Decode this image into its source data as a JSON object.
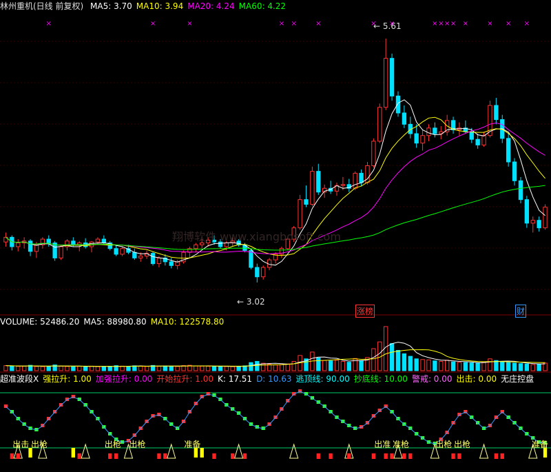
{
  "chart_data": [
    {
      "type": "candlestick",
      "title": "林州重机(日线 前复权)",
      "indicators": [
        {
          "name": "MA5",
          "value": 3.7,
          "color": "#ffffff"
        },
        {
          "name": "MA10",
          "value": 3.94,
          "color": "#ffff00"
        },
        {
          "name": "MA20",
          "value": 4.24,
          "color": "#ff00ff"
        },
        {
          "name": "MA60",
          "value": 4.22,
          "color": "#00ff00"
        }
      ],
      "annotations": {
        "high_label": "5.61",
        "low_label": "3.02"
      },
      "ylim": [
        2.8,
        5.8
      ],
      "watermark": "翔博软件 www.xiangbosoft.com",
      "events": [
        {
          "label": "涨榜",
          "color": "#ff3333"
        },
        {
          "label": "财",
          "color": "#3399ff"
        }
      ],
      "up_color": "#ff3333",
      "down_color": "#00e0ff",
      "ohlc": [
        [
          3.45,
          3.55,
          3.4,
          3.5
        ],
        [
          3.5,
          3.52,
          3.36,
          3.4
        ],
        [
          3.4,
          3.48,
          3.35,
          3.44
        ],
        [
          3.44,
          3.5,
          3.38,
          3.46
        ],
        [
          3.46,
          3.48,
          3.3,
          3.35
        ],
        [
          3.35,
          3.45,
          3.28,
          3.42
        ],
        [
          3.42,
          3.5,
          3.38,
          3.48
        ],
        [
          3.48,
          3.52,
          3.4,
          3.44
        ],
        [
          3.44,
          3.46,
          3.25,
          3.28
        ],
        [
          3.28,
          3.42,
          3.26,
          3.4
        ],
        [
          3.4,
          3.48,
          3.36,
          3.46
        ],
        [
          3.46,
          3.5,
          3.4,
          3.42
        ],
        [
          3.42,
          3.46,
          3.35,
          3.44
        ],
        [
          3.44,
          3.49,
          3.38,
          3.4
        ],
        [
          3.4,
          3.46,
          3.34,
          3.45
        ],
        [
          3.45,
          3.5,
          3.42,
          3.48
        ],
        [
          3.48,
          3.52,
          3.42,
          3.44
        ],
        [
          3.44,
          3.46,
          3.36,
          3.38
        ],
        [
          3.38,
          3.42,
          3.3,
          3.32
        ],
        [
          3.32,
          3.4,
          3.3,
          3.38
        ],
        [
          3.38,
          3.42,
          3.32,
          3.34
        ],
        [
          3.34,
          3.38,
          3.26,
          3.28
        ],
        [
          3.28,
          3.34,
          3.24,
          3.3
        ],
        [
          3.3,
          3.36,
          3.27,
          3.33
        ],
        [
          3.33,
          3.35,
          3.2,
          3.22
        ],
        [
          3.22,
          3.3,
          3.18,
          3.28
        ],
        [
          3.28,
          3.32,
          3.2,
          3.24
        ],
        [
          3.24,
          3.28,
          3.17,
          3.2
        ],
        [
          3.2,
          3.26,
          3.16,
          3.24
        ],
        [
          3.24,
          3.36,
          3.22,
          3.34
        ],
        [
          3.34,
          3.4,
          3.28,
          3.38
        ],
        [
          3.38,
          3.44,
          3.34,
          3.42
        ],
        [
          3.42,
          3.48,
          3.38,
          3.44
        ],
        [
          3.44,
          3.5,
          3.4,
          3.47
        ],
        [
          3.47,
          3.52,
          3.42,
          3.45
        ],
        [
          3.45,
          3.48,
          3.38,
          3.4
        ],
        [
          3.4,
          3.46,
          3.36,
          3.44
        ],
        [
          3.44,
          3.5,
          3.4,
          3.46
        ],
        [
          3.46,
          3.48,
          3.4,
          3.42
        ],
        [
          3.42,
          3.44,
          3.34,
          3.36
        ],
        [
          3.36,
          3.38,
          3.16,
          3.18
        ],
        [
          3.18,
          3.22,
          3.02,
          3.08
        ],
        [
          3.08,
          3.2,
          3.05,
          3.18
        ],
        [
          3.18,
          3.28,
          3.15,
          3.26
        ],
        [
          3.26,
          3.34,
          3.22,
          3.32
        ],
        [
          3.32,
          3.4,
          3.28,
          3.38
        ],
        [
          3.38,
          3.5,
          3.36,
          3.48
        ],
        [
          3.48,
          3.62,
          3.45,
          3.6
        ],
        [
          3.6,
          3.95,
          3.58,
          3.9
        ],
        [
          3.9,
          4.05,
          3.82,
          3.85
        ],
        [
          3.85,
          4.25,
          3.83,
          4.2
        ],
        [
          4.2,
          4.28,
          3.95,
          3.98
        ],
        [
          3.98,
          4.06,
          3.92,
          4.02
        ],
        [
          4.02,
          4.1,
          3.96,
          3.99
        ],
        [
          3.99,
          4.08,
          3.94,
          4.05
        ],
        [
          4.05,
          4.14,
          4.0,
          4.06
        ],
        [
          4.06,
          4.12,
          3.98,
          4.02
        ],
        [
          4.02,
          4.2,
          4.0,
          4.18
        ],
        [
          4.18,
          4.22,
          4.04,
          4.08
        ],
        [
          4.08,
          4.3,
          4.06,
          4.26
        ],
        [
          4.26,
          4.55,
          4.24,
          4.52
        ],
        [
          4.52,
          4.92,
          4.5,
          4.88
        ],
        [
          4.88,
          5.61,
          4.85,
          5.4
        ],
        [
          5.4,
          5.45,
          4.95,
          5.0
        ],
        [
          5.0,
          5.05,
          4.78,
          4.82
        ],
        [
          4.82,
          4.9,
          4.66,
          4.7
        ],
        [
          4.7,
          4.78,
          4.55,
          4.6
        ],
        [
          4.6,
          4.7,
          4.45,
          4.5
        ],
        [
          4.5,
          4.64,
          4.42,
          4.58
        ],
        [
          4.58,
          4.7,
          4.52,
          4.66
        ],
        [
          4.66,
          4.72,
          4.56,
          4.6
        ],
        [
          4.6,
          4.68,
          4.54,
          4.62
        ],
        [
          4.62,
          4.8,
          4.58,
          4.74
        ],
        [
          4.74,
          4.78,
          4.6,
          4.64
        ],
        [
          4.64,
          4.72,
          4.58,
          4.66
        ],
        [
          4.66,
          4.74,
          4.6,
          4.62
        ],
        [
          4.62,
          4.66,
          4.5,
          4.54
        ],
        [
          4.54,
          4.6,
          4.44,
          4.48
        ],
        [
          4.48,
          4.62,
          4.46,
          4.58
        ],
        [
          4.58,
          4.95,
          4.56,
          4.9
        ],
        [
          4.9,
          4.98,
          4.7,
          4.75
        ],
        [
          4.75,
          4.8,
          4.5,
          4.55
        ],
        [
          4.55,
          4.6,
          4.25,
          4.3
        ],
        [
          4.3,
          4.34,
          4.05,
          4.1
        ],
        [
          4.1,
          4.14,
          3.86,
          3.9
        ],
        [
          3.9,
          3.94,
          3.6,
          3.65
        ],
        [
          3.65,
          3.72,
          3.55,
          3.68
        ],
        [
          3.68,
          3.72,
          3.56,
          3.6
        ],
        [
          3.6,
          3.85,
          3.58,
          3.82
        ]
      ]
    },
    {
      "type": "bar",
      "title": "VOLUME",
      "indicators": [
        {
          "name": "VOLUME",
          "value": 52486.2,
          "color": "#ffffff"
        },
        {
          "name": "MA5",
          "value": 88980.8,
          "color": "#ffffff"
        },
        {
          "name": "MA10",
          "value": 122578.8,
          "color": "#ffff00"
        }
      ],
      "volume": [
        30,
        28,
        26,
        27,
        32,
        25,
        24,
        26,
        34,
        27,
        25,
        24,
        26,
        25,
        27,
        24,
        23,
        26,
        30,
        27,
        26,
        29,
        28,
        25,
        31,
        26,
        28,
        27,
        25,
        30,
        32,
        28,
        27,
        26,
        25,
        27,
        25,
        24,
        26,
        29,
        48,
        55,
        44,
        38,
        34,
        36,
        40,
        55,
        90,
        70,
        110,
        75,
        60,
        58,
        62,
        55,
        50,
        72,
        60,
        78,
        130,
        170,
        260,
        160,
        120,
        100,
        85,
        70,
        66,
        64,
        58,
        55,
        62,
        52,
        50,
        48,
        46,
        44,
        52,
        70,
        60,
        54,
        48,
        45,
        42,
        40,
        36,
        38,
        45
      ]
    },
    {
      "type": "line",
      "title": "超准波段X",
      "indicators": [
        {
          "name": "超准波段X",
          "value": "",
          "color": "#ffffff"
        },
        {
          "name": "强拉升",
          "value": "1.00",
          "color": "#ffff00"
        },
        {
          "name": "加强拉升",
          "value": "0.00",
          "color": "#ff00ff"
        },
        {
          "name": "开始拉升",
          "value": "1.00",
          "color": "#ff3333"
        },
        {
          "name": "K",
          "value": "17.51",
          "color": "#ffffff"
        },
        {
          "name": "D",
          "value": "10.63",
          "color": "#3399ff"
        },
        {
          "name": "逃顶线",
          "value": "90.00",
          "color": "#00ffff"
        },
        {
          "name": "抄底线",
          "value": "10.00",
          "color": "#00ff00"
        },
        {
          "name": "警戒",
          "value": "0.00",
          "color": "#ff66ff"
        },
        {
          "name": "出击",
          "value": "0.00",
          "color": "#ffff00"
        },
        {
          "name": "无庄控盘",
          "value": "",
          "color": "#ffffff"
        }
      ],
      "signal_labels": [
        "出击",
        "出枪",
        "出枪",
        "出枪",
        "准备",
        "出准",
        "准枪",
        "出枪",
        "出枪",
        "准备",
        "出枪"
      ],
      "k_values": [
        70,
        62,
        52,
        44,
        38,
        36,
        42,
        52,
        62,
        72,
        80,
        84,
        80,
        72,
        62,
        52,
        40,
        30,
        22,
        18,
        20,
        28,
        38,
        48,
        56,
        58,
        52,
        44,
        38,
        48,
        62,
        74,
        84,
        88,
        86,
        80,
        72,
        66,
        60,
        52,
        44,
        40,
        38,
        44,
        54,
        66,
        78,
        88,
        92,
        88,
        82,
        76,
        70,
        62,
        54,
        48,
        42,
        38,
        40,
        46,
        56,
        64,
        70,
        62,
        52,
        44,
        38,
        30,
        24,
        18,
        16,
        22,
        32,
        46,
        58,
        62,
        54,
        46,
        38,
        42,
        54,
        62,
        54,
        46,
        38,
        30,
        24,
        18,
        17
      ]
    }
  ]
}
